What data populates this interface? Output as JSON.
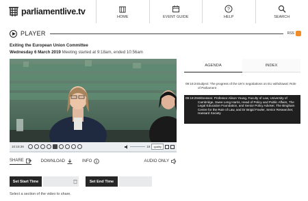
{
  "brand": {
    "name": "parliamentlive.tv",
    "logo_icon": "portcullis-icon"
  },
  "nav": [
    {
      "label": "HOME",
      "icon": "home-icon"
    },
    {
      "label": "EVENT GUIDE",
      "icon": "calendar-icon"
    },
    {
      "label": "HELP",
      "icon": "help-icon"
    },
    {
      "label": "SEARCH",
      "icon": "search-icon"
    }
  ],
  "player": {
    "title": "PLAYER",
    "rss_label": "RSS",
    "rss_color": "#f28c28"
  },
  "meeting": {
    "title": "Exiting the European Union Committee",
    "date": "Wednesday 6 March 2019",
    "status": "Meeting started at 9:18am, ended 10:56am"
  },
  "video_controls": {
    "time": "10:15:36",
    "volume": "18",
    "quality": "quality"
  },
  "actions": {
    "share": "SHARE",
    "download": "DOWNLOAD",
    "info": "INFO",
    "audio_only": "AUDIO ONLY"
  },
  "clip": {
    "start_label": "Set Start Time",
    "end_label": "Set End Time",
    "hint": "Select a section of the video to share."
  },
  "tabs": [
    {
      "label": "AGENDA"
    },
    {
      "label": "INDEX"
    }
  ],
  "index": [
    {
      "time": "09:18:24",
      "text": "Subject: The progress of the UK's negotiations on EU withdrawal: Role of Parliament"
    },
    {
      "time": "09:18:25",
      "text": "Witnesses: Professor Alison Young, Faculty of Law, University of Cambridge, Swee Leng Harris, Head of Policy and Public Affairs, The Legal Education Foundation, and Senior Policy Adviser, The Bingham Centre for the Rule of Law, and Dr Brigid Fowler, Senior Researcher, Hansard Society"
    }
  ]
}
